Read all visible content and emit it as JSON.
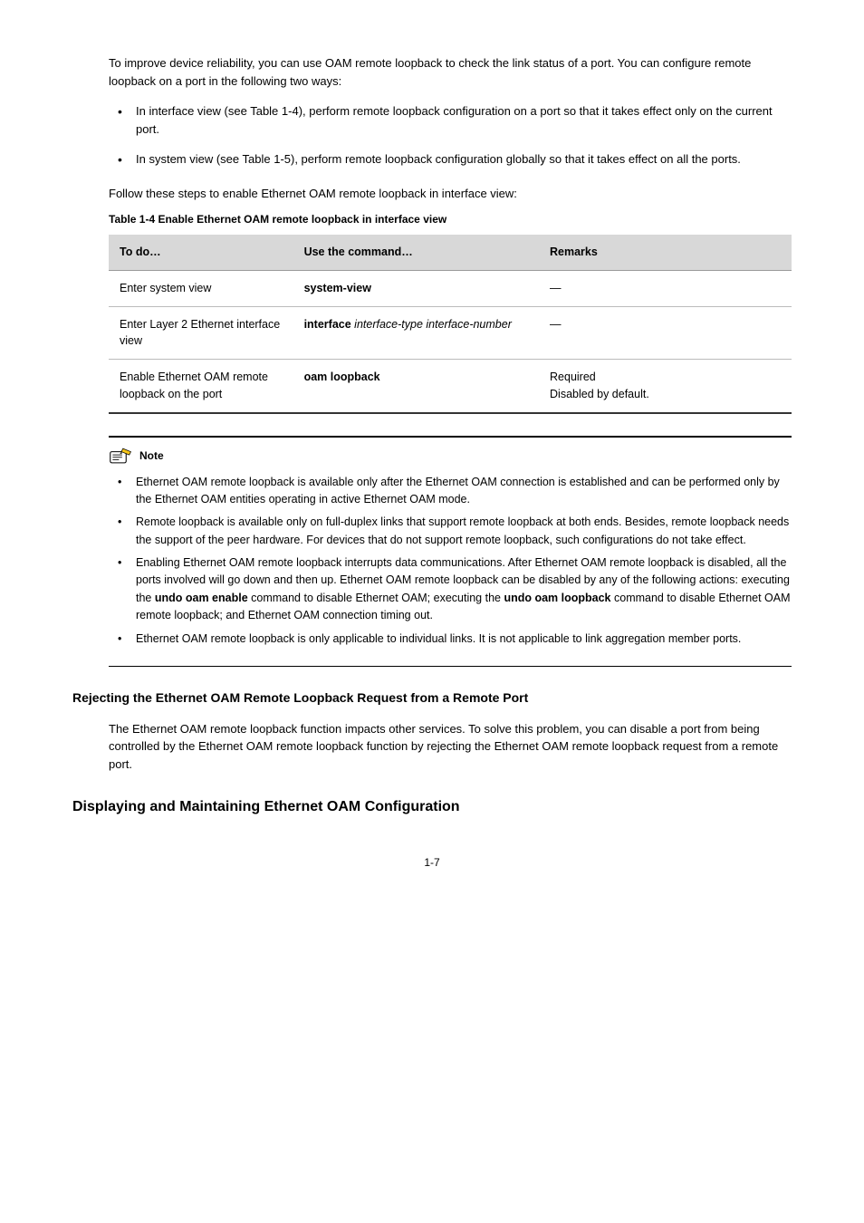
{
  "intro": "To improve device reliability, you can use OAM remote loopback to check the link status of a port. You can configure remote loopback on a port in the following two ways:",
  "bullets_top": [
    "In interface view (see Table 1-4), perform remote loopback configuration on a port so that it takes effect only on the current port.",
    "In system view (see Table 1-5), perform remote loopback configuration globally so that it takes effect on all the ports."
  ],
  "follow_bullets": "Follow these steps to enable Ethernet OAM remote loopback in interface view:",
  "table_caption": "Table 1-4 Enable Ethernet OAM remote loopback in interface view",
  "table": {
    "headers": [
      "To do…",
      "Use the command…",
      "Remarks"
    ],
    "rows": [
      {
        "todo": "Enter system view",
        "cmd_bold": "system-view",
        "cmd_italic": "",
        "remarks": "—"
      },
      {
        "todo": "Enter Layer 2 Ethernet interface view",
        "cmd_bold": "interface ",
        "cmd_italic": "interface-type interface-number",
        "remarks": "—"
      },
      {
        "todo": "Enable Ethernet OAM remote loopback on the port",
        "cmd_bold": "oam loopback",
        "cmd_italic": "",
        "remarks": "Required\nDisabled by default."
      }
    ]
  },
  "note_label": "Note",
  "note_items": [
    {
      "plain": "Ethernet OAM remote loopback is available only after the Ethernet OAM connection is established and can be performed only by the Ethernet OAM entities operating in active Ethernet OAM mode."
    },
    {
      "plain": "Remote loopback is available only on full-duplex links that support remote loopback at both ends. Besides, remote loopback needs the support of the peer hardware. For devices that do not support remote loopback, such configurations do not take effect."
    },
    {
      "plain_prefix": "Enabling Ethernet OAM remote loopback interrupts data communications. After Ethernet OAM remote loopback is disabled, all the ports involved will go down and then up. Ethernet OAM remote loopback can be disabled by any of the following actions: executing the ",
      "bold1": "undo oam enable",
      "mid1": " command to disable Ethernet OAM; executing the ",
      "bold2": "undo oam loopback",
      "mid2": " command to disable Ethernet OAM remote loopback; and Ethernet OAM connection timing out."
    },
    {
      "plain": "Ethernet OAM remote loopback is only applicable to individual links. It is not applicable to link aggregation member ports."
    }
  ],
  "heading_rejecting": "Rejecting the Ethernet OAM Remote Loopback Request from a Remote Port",
  "rejecting_body": "The Ethernet OAM remote loopback function impacts other services. To solve this problem, you can disable a port from being controlled by the Ethernet OAM remote loopback function by rejecting the Ethernet OAM remote loopback request from a remote port.",
  "heading_display": "Displaying and Maintaining Ethernet OAM Configuration",
  "page_num": "1-7"
}
